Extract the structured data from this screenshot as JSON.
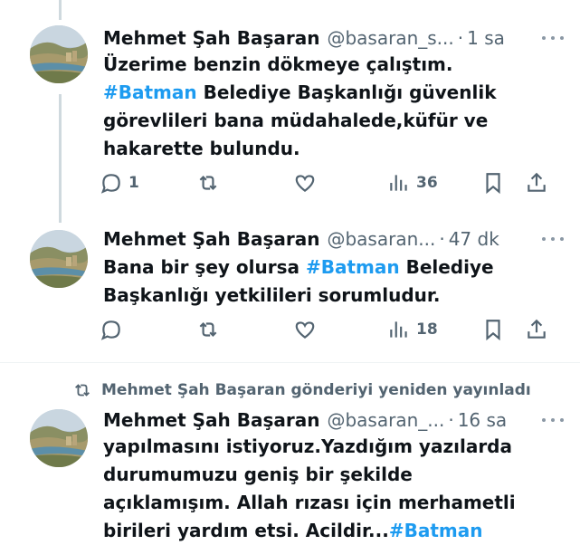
{
  "tweets": [
    {
      "name": "Mehmet Şah Başaran",
      "handle": "@basaran_s...",
      "time": "1 sa",
      "lines": [
        [
          {
            "t": "Üzerime benzin dökmeye çalıştım."
          }
        ],
        [
          {
            "t": "#Batman",
            "tag": true
          },
          {
            "t": " Belediye Başkanlığı güvenlik"
          }
        ],
        [
          {
            "t": "görevlileri bana müdahalede,küfür ve"
          }
        ],
        [
          {
            "t": "hakarette bulundu."
          }
        ]
      ],
      "replies": "1",
      "retweets": "",
      "likes": "",
      "views": "36"
    },
    {
      "name": "Mehmet Şah Başaran",
      "handle": "@basaran...",
      "time": "47 dk",
      "lines": [
        [
          {
            "t": "Bana bir şey olursa "
          },
          {
            "t": "#Batman",
            "tag": true
          },
          {
            "t": " Belediye"
          }
        ],
        [
          {
            "t": "Başkanlığı yetkilileri sorumludur."
          }
        ]
      ],
      "replies": "",
      "retweets": "",
      "likes": "",
      "views": "18"
    },
    {
      "name": "Mehmet Şah Başaran",
      "handle": "@basaran_...",
      "time": "16 sa",
      "lines": [
        [
          {
            "t": "yapılmasını istiyoruz.Yazdığım yazılarda"
          }
        ],
        [
          {
            "t": "durumumuzu geniş bir şekilde"
          }
        ],
        [
          {
            "t": "açıklamışım. Allah rızası için merhametli"
          }
        ],
        [
          {
            "t": "birileri yardım etsi. Acildir..."
          },
          {
            "t": "#Batman",
            "tag": true
          }
        ]
      ]
    }
  ],
  "retweet_banner": "Mehmet Şah Başaran gönderiyi yeniden yayınladı",
  "colors": {
    "hashtag": "#1d9bf0",
    "secondary": "#536471",
    "text": "#0f1419"
  },
  "icons": [
    "reply-icon",
    "retweet-icon",
    "like-icon",
    "views-icon",
    "bookmark-icon",
    "share-icon",
    "more-icon"
  ]
}
